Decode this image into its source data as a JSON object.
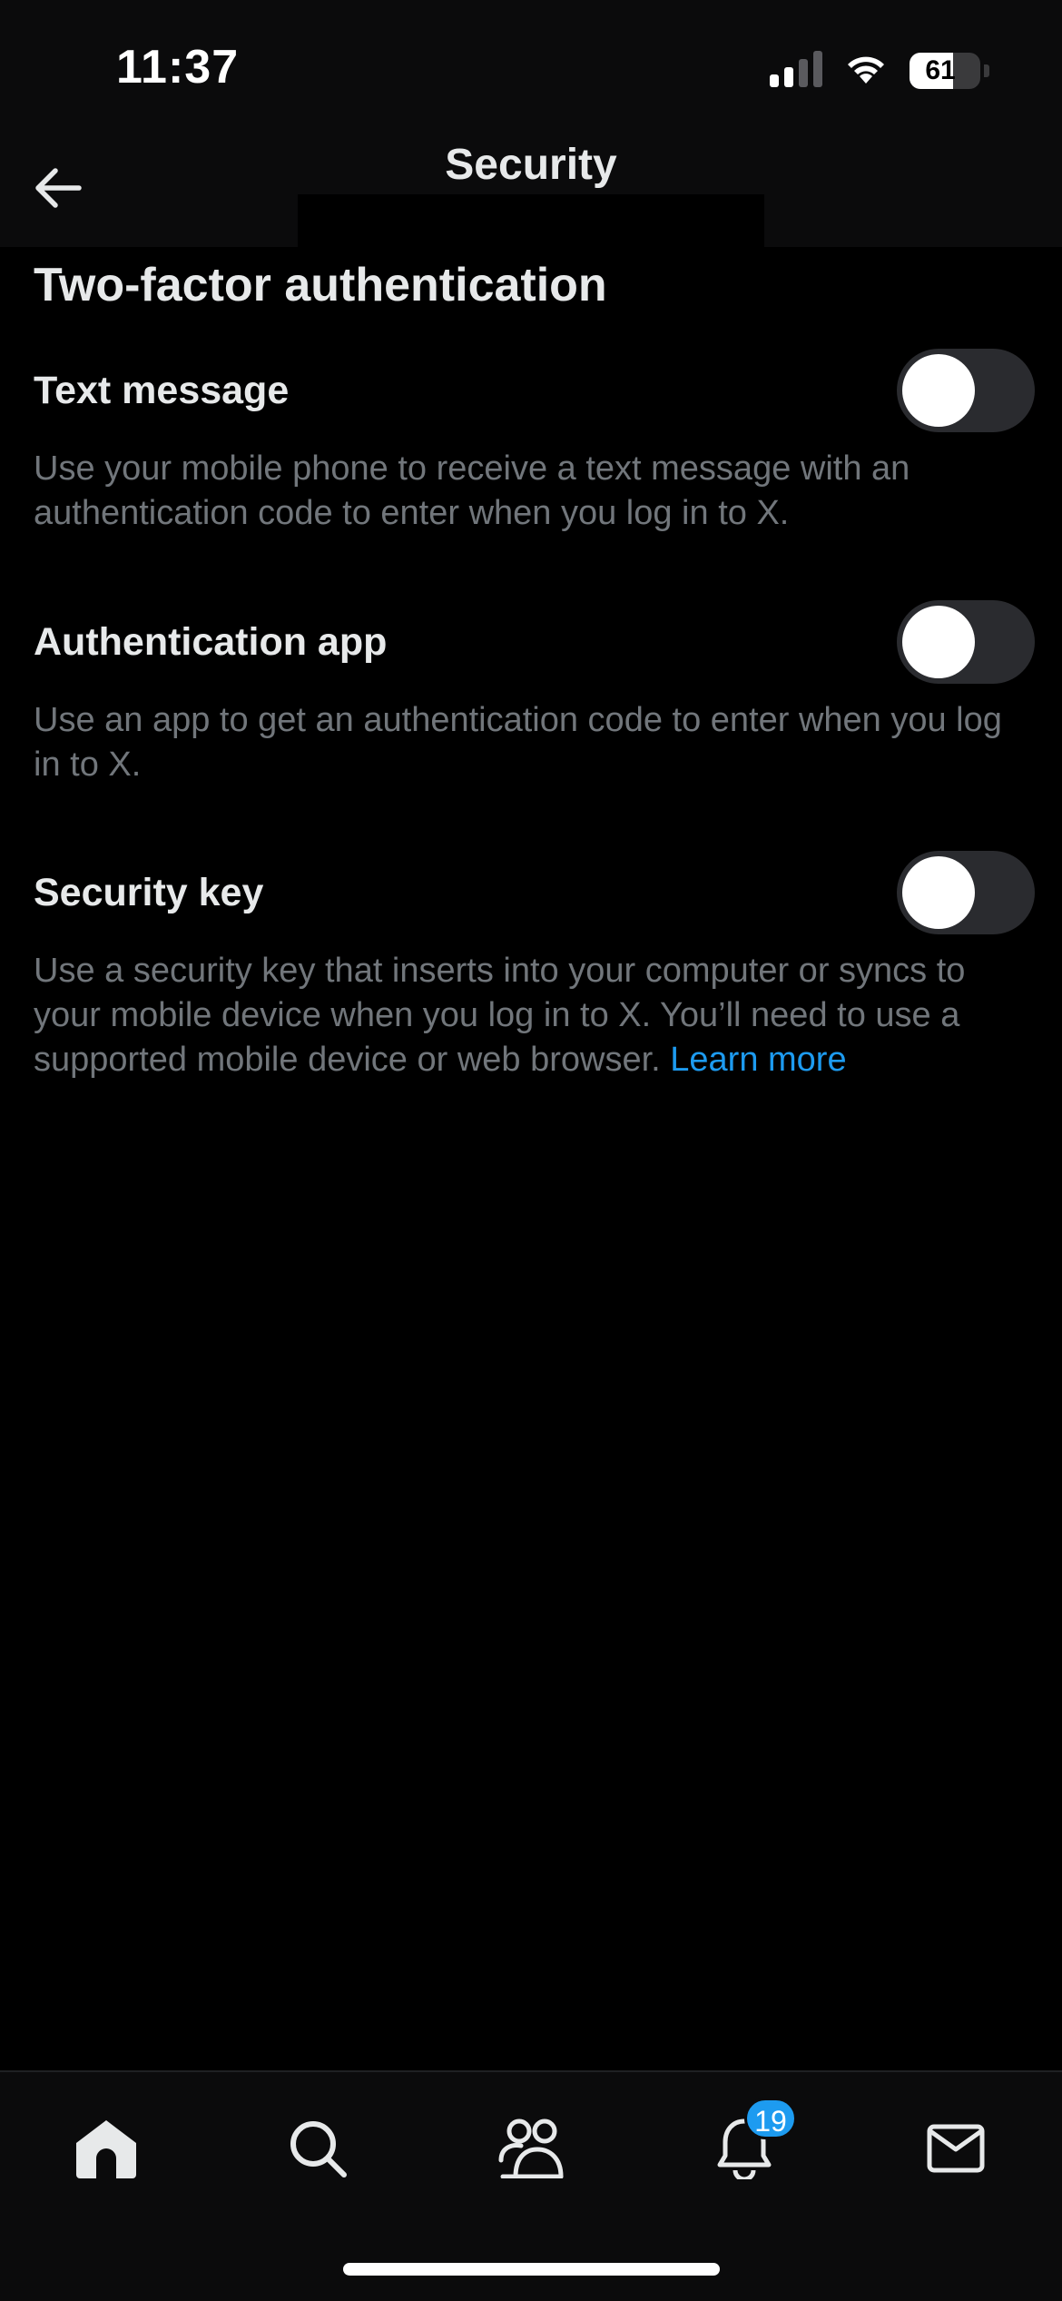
{
  "status_bar": {
    "time": "11:37",
    "battery": "61",
    "battery_level": 0.61,
    "signal_icon": "cellular-signal-icon",
    "wifi_icon": "wifi-icon"
  },
  "header": {
    "title": "Security",
    "back_icon": "arrow-left-icon"
  },
  "section": {
    "heading": "Two-factor authentication"
  },
  "options": [
    {
      "label": "Text message",
      "description": "Use your mobile phone to receive a text message with an authentication code to enter when you log in to X.",
      "enabled": false
    },
    {
      "label": "Authentication app",
      "description": "Use an app to get an authentication code to enter when you log in to X.",
      "enabled": false
    },
    {
      "label": "Security key",
      "description": "Use a security key that inserts into your computer or syncs to your mobile device when you log in to X. You’ll need to use a supported mobile device or web browser.",
      "link": "Learn more",
      "enabled": false
    }
  ],
  "tab_bar": {
    "tabs": [
      {
        "name": "home",
        "icon": "home-icon"
      },
      {
        "name": "search",
        "icon": "search-icon"
      },
      {
        "name": "communities",
        "icon": "communities-icon"
      },
      {
        "name": "notifications",
        "icon": "bell-icon",
        "badge": "19"
      },
      {
        "name": "messages",
        "icon": "mail-icon"
      }
    ]
  },
  "colors": {
    "background": "#000000",
    "accent": "#1d9bf0",
    "secondary_text": "#71767b",
    "toggle_off": "#2a2b2f"
  }
}
